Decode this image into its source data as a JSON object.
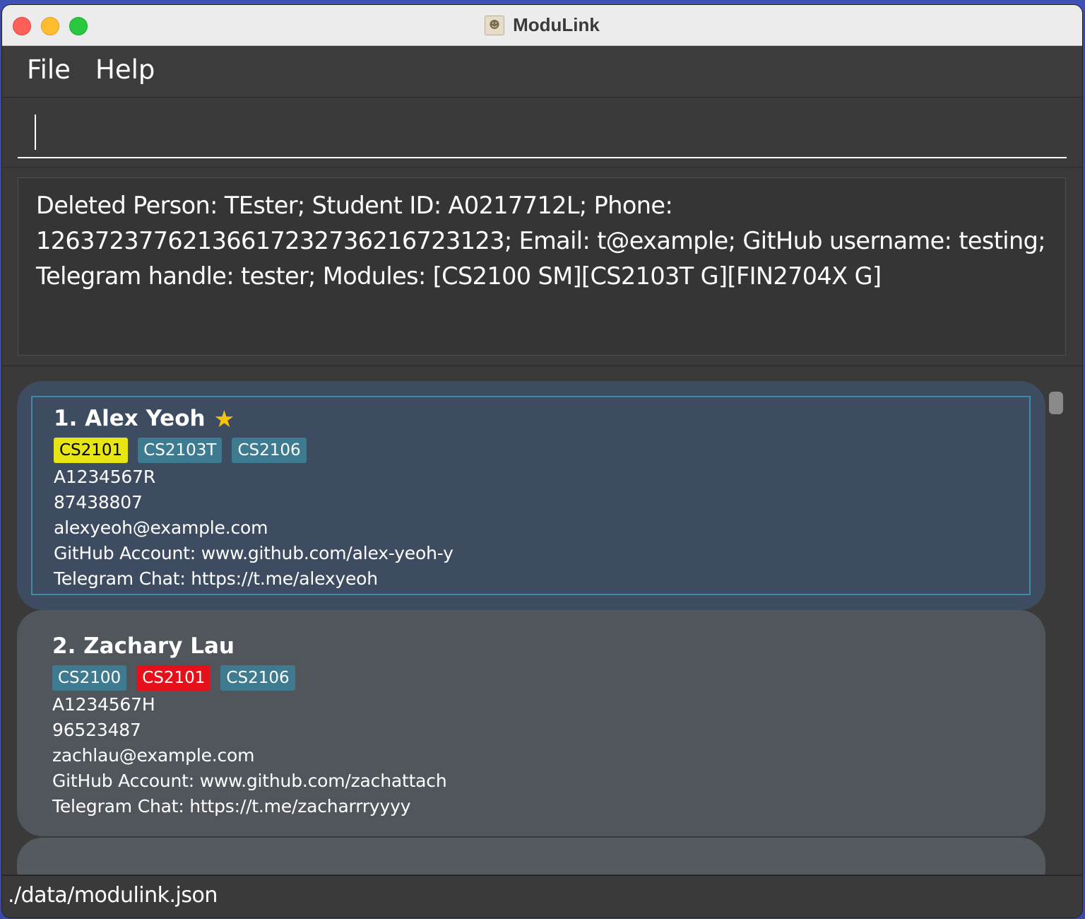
{
  "window": {
    "title": "ModuLink"
  },
  "menu": {
    "file": "File",
    "help": "Help"
  },
  "command": {
    "value": ""
  },
  "result": {
    "line1": "Deleted Person: TEster; Student ID: A0217712L; Phone:",
    "line2": "12637237762136617232736216723123; Email: t@example; GitHub username: testing;",
    "line3": "Telegram handle: tester; Modules: [CS2100 SM][CS2103T G][FIN2704X G]"
  },
  "persons": [
    {
      "name": "1. Alex Yeoh",
      "favourite": true,
      "tags": [
        {
          "label": "CS2101",
          "color": "#e7e514"
        },
        {
          "label": "CS2103T",
          "color": "#3e7b91"
        },
        {
          "label": "CS2106",
          "color": "#3e7b91"
        }
      ],
      "student_id": "A1234567R",
      "phone": "87438807",
      "email": "alexyeoh@example.com",
      "github": "GitHub Account: www.github.com/alex-yeoh-y",
      "telegram": "Telegram Chat: https://t.me/alexyeoh",
      "selected": true
    },
    {
      "name": "2. Zachary Lau",
      "favourite": false,
      "tags": [
        {
          "label": "CS2100",
          "color": "#3e7b91"
        },
        {
          "label": "CS2101",
          "color": "#e6101a"
        },
        {
          "label": "CS2106",
          "color": "#3e7b91"
        }
      ],
      "student_id": "A1234567H",
      "phone": "96523487",
      "email": "zachlau@example.com",
      "github": "GitHub Account: www.github.com/zachattach",
      "telegram": "Telegram Chat: https://t.me/zacharrryyyy",
      "selected": false
    }
  ],
  "status": {
    "path": "./data/modulink.json"
  },
  "colors": {
    "accent_selection": "#3f8aa6",
    "favourite_star": "#f4c20d"
  }
}
